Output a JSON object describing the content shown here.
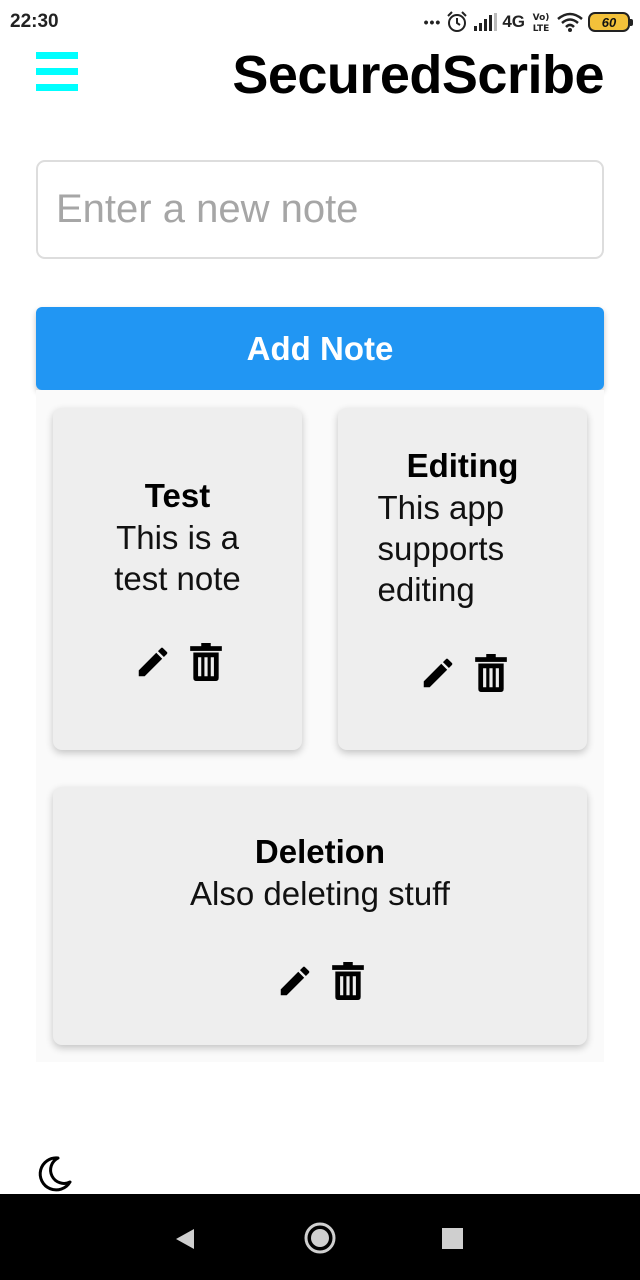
{
  "status_bar": {
    "time": "22:30",
    "dots": "•••",
    "network": "4G",
    "volte": "Vo) LTE",
    "battery": "60"
  },
  "header": {
    "title": "SecuredScribe",
    "menu_icon": "hamburger-icon",
    "accent_color": "#00ffff"
  },
  "note_input": {
    "placeholder": "Enter a new note",
    "value": ""
  },
  "add_button": {
    "label": "Add Note",
    "color": "#2196f3"
  },
  "notes": [
    {
      "title": "Test",
      "body": "This is a test note"
    },
    {
      "title": "Editing",
      "body": "This app supports editing"
    },
    {
      "title": "Deletion",
      "body": "Also deleting stuff"
    }
  ],
  "note_icons": {
    "edit": "pencil-icon",
    "delete": "trash-icon"
  },
  "theme_toggle": {
    "icon": "moon-icon"
  },
  "nav_bar": {
    "back": "back-icon",
    "home": "home-icon",
    "recents": "recents-icon"
  }
}
